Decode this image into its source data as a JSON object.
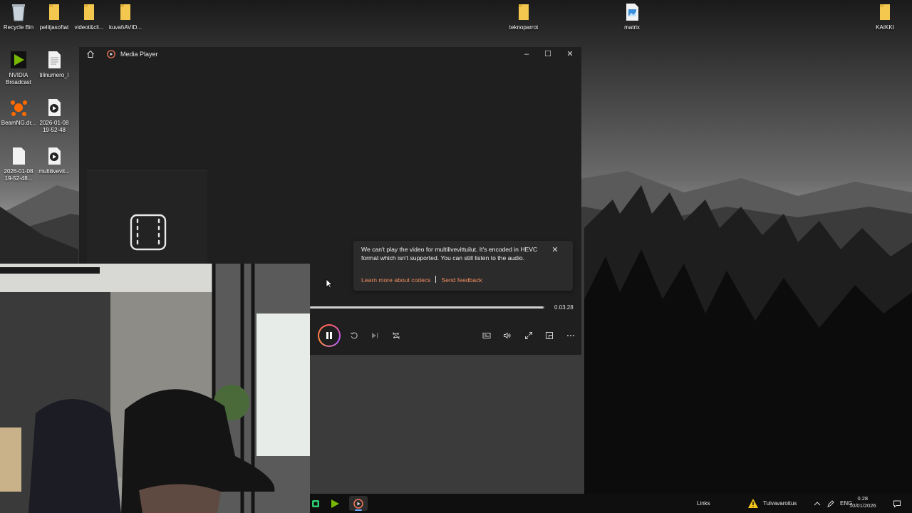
{
  "desktop": {
    "icons": [
      {
        "label": "Recycle Bin",
        "icon": "recycle-bin-icon"
      },
      {
        "label": "pelitjasoftat",
        "icon": "folder-icon"
      },
      {
        "label": "videot&cli...",
        "icon": "folder-icon"
      },
      {
        "label": "kuvat\\AVID...",
        "icon": "folder-icon"
      },
      {
        "label": "teknoparrot",
        "icon": "folder-icon"
      },
      {
        "label": "matrix",
        "icon": "image-file-icon"
      },
      {
        "label": "KAIKKI",
        "icon": "folder-icon"
      },
      {
        "label": "NVIDIA\nBroadcast",
        "icon": "nvidia-broadcast-icon"
      },
      {
        "label": "tilinumero_l",
        "icon": "text-file-icon"
      },
      {
        "label": "BeamNG.dr...",
        "icon": "beamng-icon"
      },
      {
        "label": "2026-01-08\n19-52-48",
        "icon": "video-file-icon"
      },
      {
        "label": "2026-01-08\n19-52-48...",
        "icon": "text-file-icon"
      },
      {
        "label": "multilivevit...",
        "icon": "video-file-icon"
      }
    ]
  },
  "media_player": {
    "title": "Media Player",
    "window_controls": {
      "minimize": "–",
      "maximize": "☐",
      "close": "✕"
    },
    "toast": {
      "message": "We can't play the video for multilivevittuilut. It's encoded in HEVC format which isn't supported. You can still listen to the audio.",
      "link_codecs": "Learn more about codecs",
      "link_feedback": "Send feedback",
      "close": "✕"
    },
    "seek": {
      "progress": 0.995,
      "time": "0.03.28"
    },
    "state": "playing"
  },
  "taskbar": {
    "apps": [
      "app-icon",
      "nvidia-broadcast-icon",
      "media-player-icon"
    ],
    "links_label": "Links",
    "weather_label": "Tulvavaroitus",
    "language": "ENG",
    "time": "0.28",
    "date": "10/01/2026"
  },
  "colors": {
    "accent_link": "#f08c60",
    "window_bg": "#1f1f1f",
    "toast_bg": "#2b2b2b"
  }
}
